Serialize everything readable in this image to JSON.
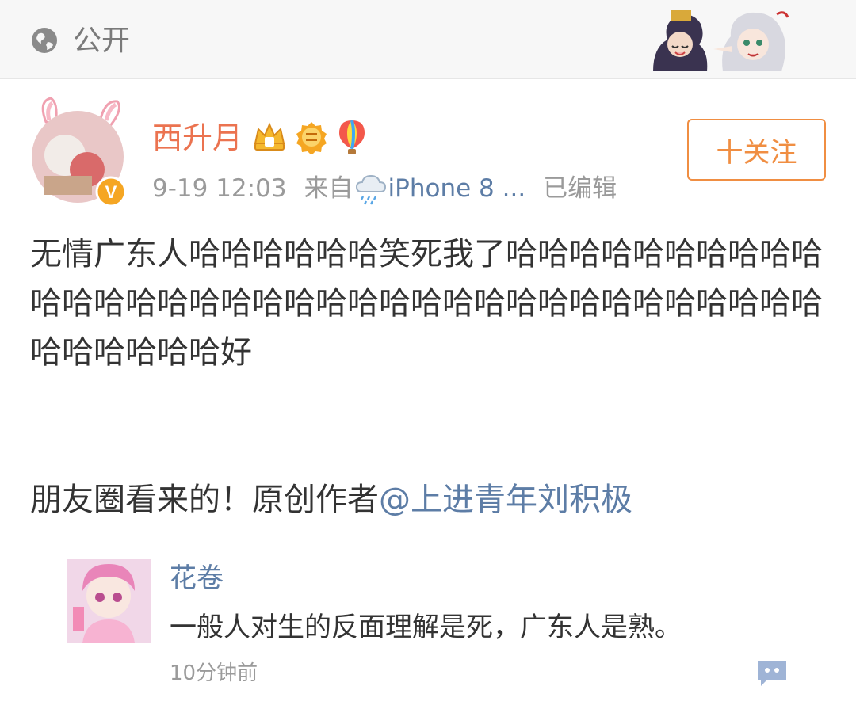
{
  "topbar": {
    "visibility_label": "公开",
    "globe_icon": "globe-icon",
    "sticker": "anime-sticker"
  },
  "post": {
    "author": "西升月",
    "badges": [
      "crown-badge",
      "answer-badge",
      "balloon-badge"
    ],
    "verified_badge": "V",
    "date": "9-19 12:03",
    "source_prefix": "来自",
    "source_device": "iPhone 8 ...",
    "edited": "已编辑",
    "follow_label": "十关注",
    "text": "无情广东人哈哈哈哈哈哈笑死我了哈哈哈哈哈哈哈哈哈哈哈哈哈哈哈哈哈哈哈哈哈哈哈哈哈哈哈哈哈哈哈哈哈哈哈哈哈哈哈哈哈好",
    "line2_prefix": "朋友圈看来的！原创作者",
    "mention": "@上进青年刘积极"
  },
  "comment": {
    "name": "花卷",
    "text": "一般人对生的反面理解是死，广东人是熟。",
    "time": "10分钟前",
    "icon": "comment-icon"
  },
  "colors": {
    "accent_orange": "#eb7350",
    "follow_orange": "#f08e42",
    "link_blue": "#5d7da6",
    "meta_gray": "#9a9a9a"
  }
}
